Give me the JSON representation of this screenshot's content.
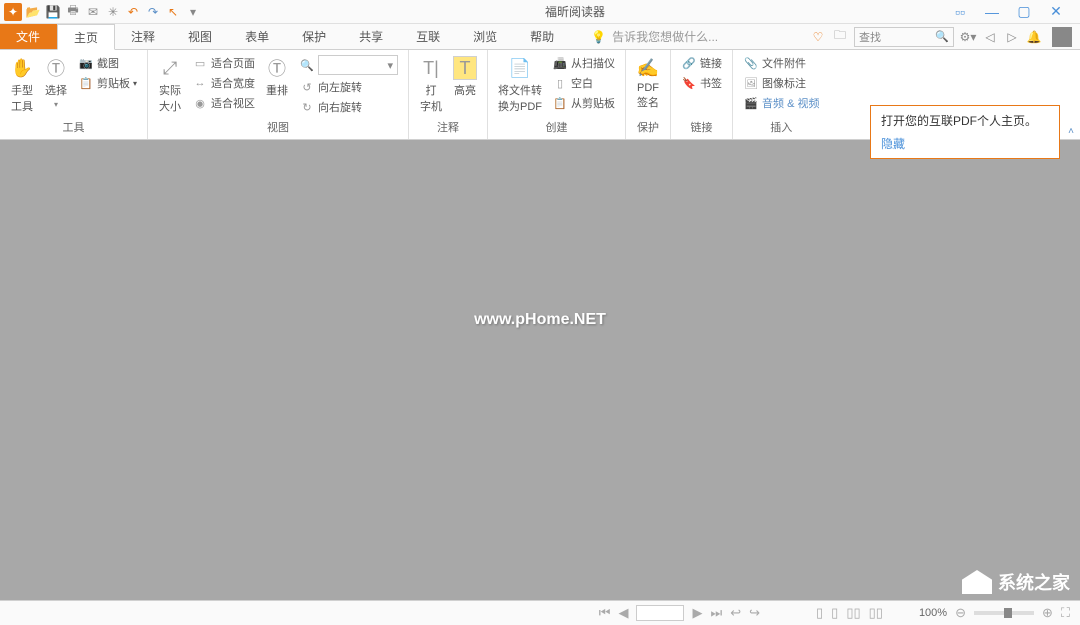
{
  "title": "福昕阅读器",
  "tabs": {
    "file": "文件",
    "home": "主页",
    "comment": "注释",
    "view": "视图",
    "form": "表单",
    "protect": "保护",
    "share": "共享",
    "connect": "互联",
    "browse": "浏览",
    "help": "帮助"
  },
  "tell_me": "告诉我您想做什么...",
  "search": {
    "placeholder": "查找"
  },
  "ribbon": {
    "tools": {
      "label": "工具",
      "hand": "手型\n工具",
      "select": "选择"
    },
    "tools2": {
      "screenshot": "截图",
      "clipboard": "剪贴板"
    },
    "view": {
      "label": "视图",
      "actual": "实际\n大小",
      "fit_page": "适合页面",
      "fit_width": "适合宽度",
      "fit_visible": "适合视区",
      "reflow": "重排",
      "rotate_left": "向左旋转",
      "rotate_right": "向右旋转"
    },
    "comment": {
      "label": "注释",
      "typewriter": "打\n字机",
      "highlight": "高亮"
    },
    "create": {
      "label": "创建",
      "convert": "将文件转\n换为PDF",
      "scanner": "从扫描仪",
      "blank": "空白",
      "clipboard": "从剪贴板"
    },
    "protect": {
      "label": "保护",
      "sign": "PDF\n签名"
    },
    "links": {
      "label": "链接",
      "link": "链接",
      "bookmark": "书签"
    },
    "insert": {
      "label": "插入",
      "attach": "文件附件",
      "imgnote": "图像标注",
      "media": "音频 & 视频"
    }
  },
  "tooltip": {
    "text": "打开您的互联PDF个人主页。",
    "hide": "隐藏"
  },
  "watermark": "www.pHome.NET",
  "corner_logo": "系统之家",
  "status": {
    "zoom": "100%"
  }
}
